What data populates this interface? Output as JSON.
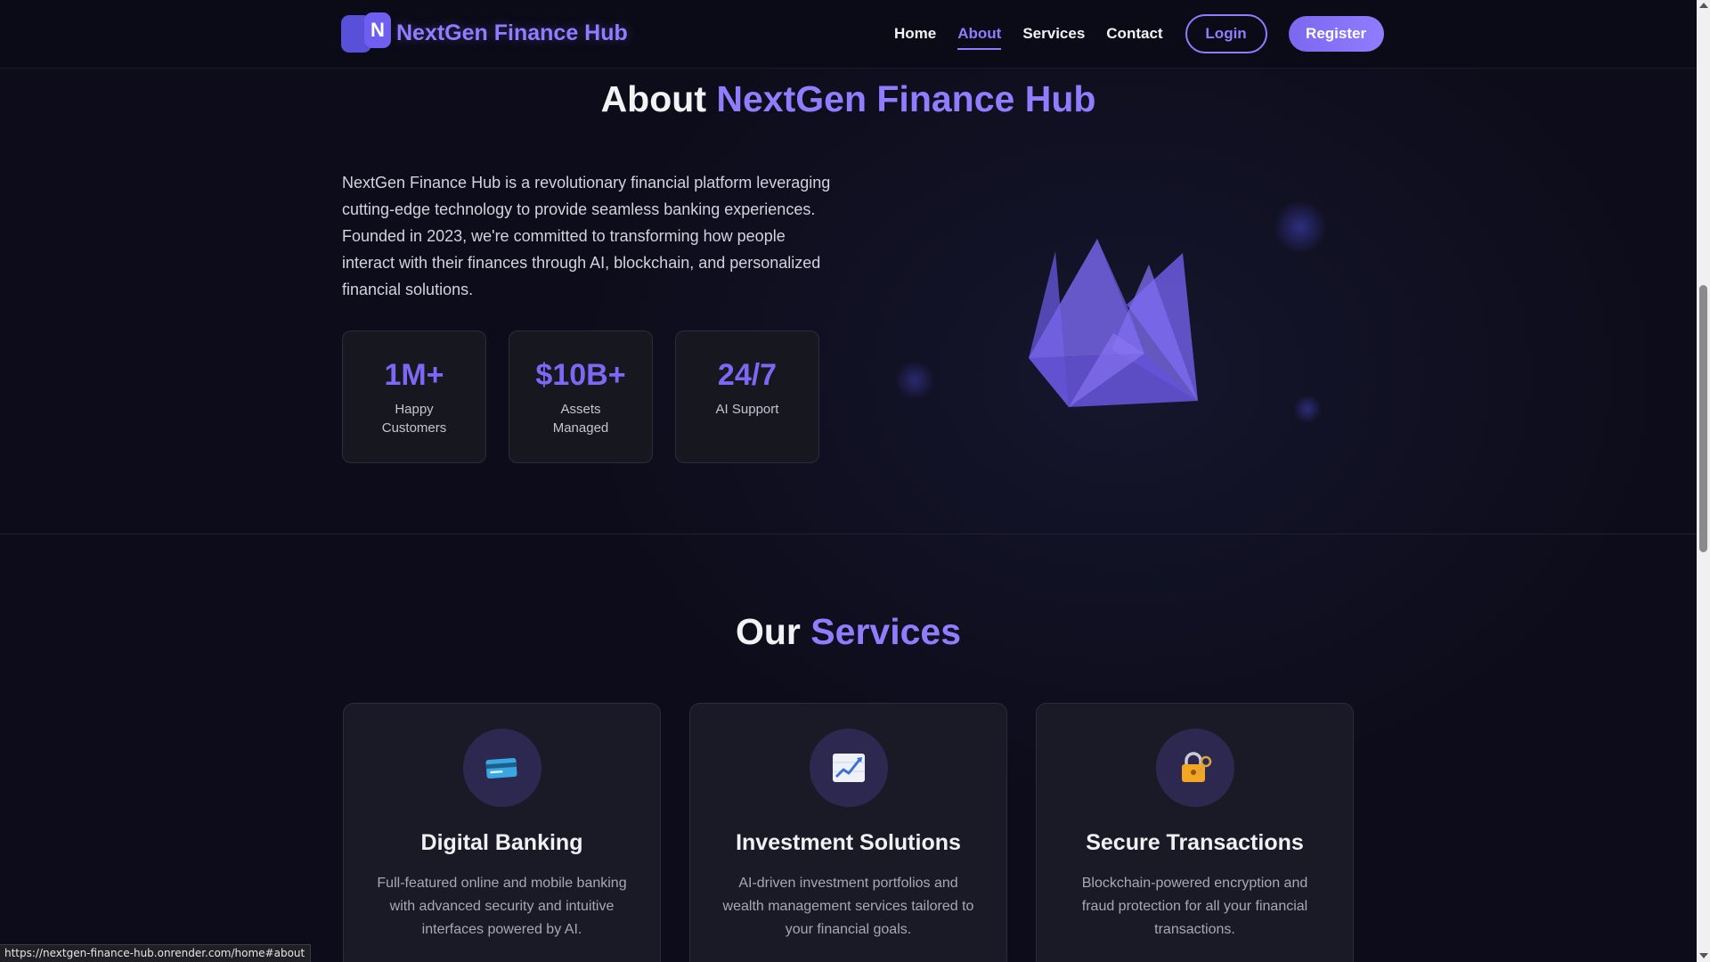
{
  "brand": {
    "logo_letter": "N",
    "name": "NextGen Finance Hub"
  },
  "nav": {
    "links": [
      {
        "label": "Home",
        "active": false
      },
      {
        "label": "About",
        "active": true
      },
      {
        "label": "Services",
        "active": false
      },
      {
        "label": "Contact",
        "active": false
      }
    ],
    "login_label": "Login",
    "register_label": "Register"
  },
  "about": {
    "title_prefix": "About",
    "title_accent": "NextGen Finance Hub",
    "description": "NextGen Finance Hub is a revolutionary financial platform leveraging cutting-edge technology to provide seamless banking experiences. Founded in 2023, we're committed to transforming how people interact with their finances through AI, blockchain, and personalized financial solutions.",
    "stats": [
      {
        "value": "1M+",
        "label": "Happy Customers"
      },
      {
        "value": "$10B+",
        "label": "Assets Managed"
      },
      {
        "value": "24/7",
        "label": "AI Support"
      }
    ]
  },
  "services": {
    "title_prefix": "Our",
    "title_accent": "Services",
    "cards": [
      {
        "icon": "credit-card-icon",
        "title": "Digital Banking",
        "description": "Full-featured online and mobile banking with advanced security and intuitive interfaces powered by AI."
      },
      {
        "icon": "chart-increasing-icon",
        "title": "Investment Solutions",
        "description": "AI-driven investment portfolios and wealth management services tailored to your financial goals."
      },
      {
        "icon": "lock-with-key-icon",
        "title": "Secure Transactions",
        "description": "Blockchain-powered encryption and fraud protection for all your financial transactions."
      }
    ]
  },
  "status_bar": {
    "url": "https://nextgen-finance-hub.onrender.com/home#about"
  },
  "colors": {
    "accent": "#8f7cff",
    "background": "#0c0c1a",
    "card": "#1a1a26"
  }
}
